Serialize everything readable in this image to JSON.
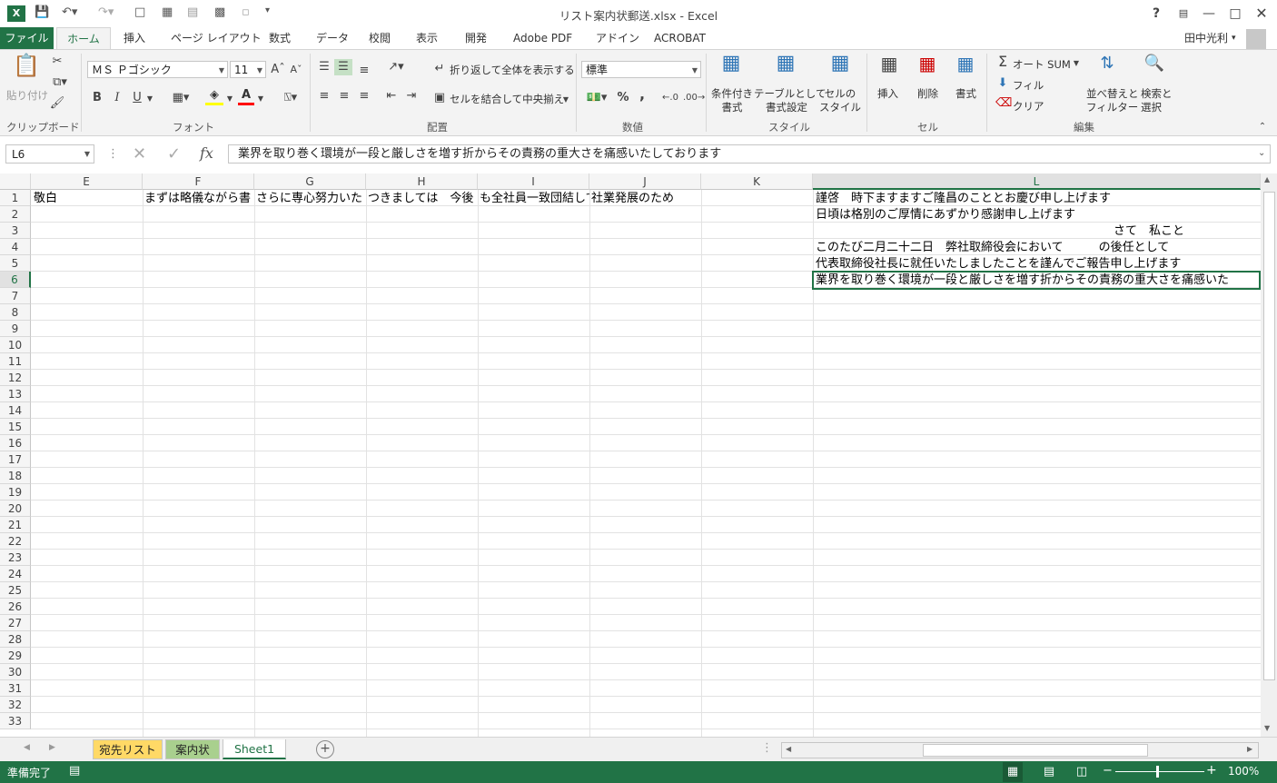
{
  "window": {
    "title": "リスト案内状郵送.xlsx - Excel",
    "help": "?",
    "user": "田中光利"
  },
  "tabs": [
    "ファイル",
    "ホーム",
    "挿入",
    "ページ レイアウト",
    "数式",
    "データ",
    "校閲",
    "表示",
    "開発",
    "Adobe PDF",
    "アドイン",
    "ACROBAT"
  ],
  "ribbon": {
    "clipboard": {
      "paste": "貼り付け",
      "label": "クリップボード"
    },
    "font": {
      "name": "ＭＳ Ｐゴシック",
      "size": "11",
      "label": "フォント",
      "bold": "B",
      "italic": "I",
      "underline": "U"
    },
    "alignment": {
      "wrap": "折り返して全体を表示する",
      "merge": "セルを結合して中央揃え",
      "label": "配置"
    },
    "number": {
      "format": "標準",
      "label": "数値",
      "percent": "%",
      "comma": ","
    },
    "styles": {
      "conditional": [
        "条件付き",
        "書式"
      ],
      "table": [
        "テーブルとして",
        "書式設定"
      ],
      "cell": [
        "セルの",
        "スタイル"
      ],
      "label": "スタイル"
    },
    "cells": {
      "insert": "挿入",
      "delete": "削除",
      "format": "書式",
      "label": "セル"
    },
    "editing": {
      "autosum": "オート SUM",
      "fill": "フィル",
      "clear": "クリア",
      "sort": [
        "並べ替えと",
        "フィルター"
      ],
      "find": [
        "検索と",
        "選択"
      ],
      "label": "編集"
    }
  },
  "formula_bar": {
    "name_box": "L6",
    "fx": "fx",
    "content": "業界を取り巻く環境が一段と厳しさを増す折からその責務の重大さを痛感いたしております"
  },
  "grid": {
    "columns": [
      "E",
      "F",
      "G",
      "H",
      "I",
      "J",
      "K",
      "L"
    ],
    "rows": [
      "1",
      "2",
      "3",
      "4",
      "5",
      "6",
      "7",
      "8",
      "9",
      "10",
      "11",
      "12",
      "13",
      "14",
      "15",
      "16",
      "17",
      "18",
      "19",
      "20",
      "21",
      "22",
      "23",
      "24",
      "25",
      "26",
      "27",
      "28",
      "29",
      "30",
      "31",
      "32",
      "33"
    ],
    "row1": {
      "E": "敬白",
      "F": "まずは略儀ながら書",
      "G": "さらに専心努力いた",
      "H": "つきましては　今後",
      "I": "も全社員一致団結して",
      "J": "社業発展のため"
    },
    "L": [
      "謹啓　時下ますますご隆昌のこととお慶び申し上げます",
      "日頃は格別のご厚情にあずかり感謝申し上げます",
      "さて　私こと",
      "このたび二月二十二日　弊社取締役会において　　　の後任として",
      "代表取締役社長に就任いたしましたことを謹んでご報告申し上げます",
      "業界を取り巻く環境が一段と厳しさを増す折からその責務の重大さを痛感いた"
    ],
    "selected_column": "L",
    "selected_row": "6"
  },
  "sheets": [
    "宛先リスト",
    "案内状",
    "Sheet1"
  ],
  "status": {
    "ready": "準備完了",
    "zoom": "100%"
  },
  "colors": {
    "excel_green": "#217346",
    "tab_yellow": "#ffd966",
    "tab_green": "#a9d08e"
  }
}
